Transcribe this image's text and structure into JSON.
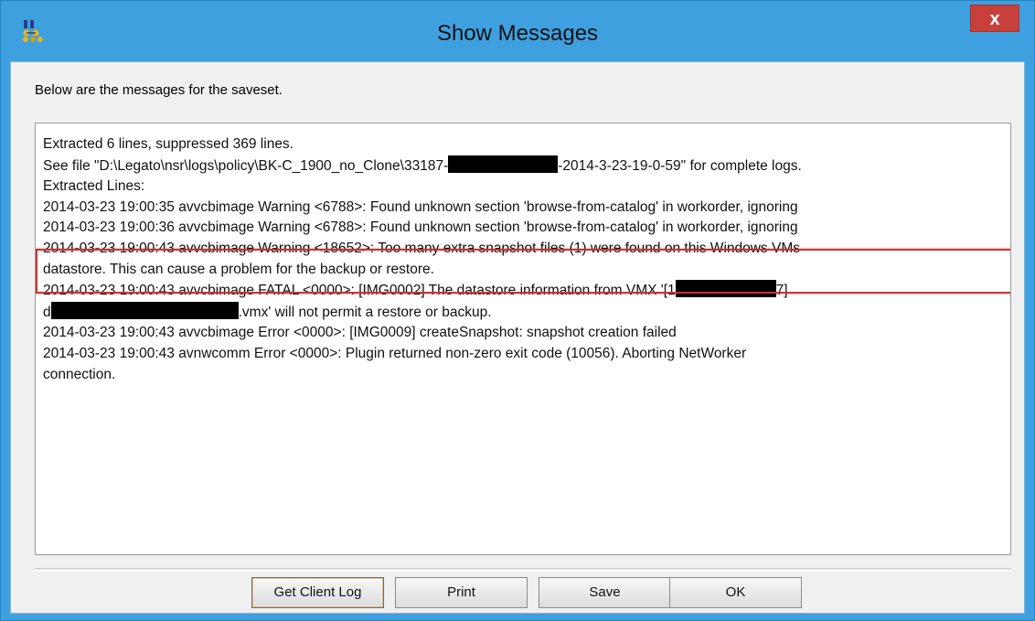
{
  "window": {
    "title": "Show Messages",
    "close_label": "x",
    "app_icon": "legato-networker-icon"
  },
  "intro_text": "Below are the messages for the saveset.",
  "messages": {
    "line1": "Extracted 6 lines, suppressed 369 lines.",
    "line2_before": "See file \"D:\\Legato\\nsr\\logs\\policy\\BK-C_1900_no_Clone\\33187-",
    "line2_after": "-2014-3-23-19-0-59\" for complete logs.",
    "line3": "Extracted Lines:",
    "line4": "2014-03-23 19:00:35 avvcbimage Warning <6788>: Found unknown section 'browse-from-catalog' in workorder, ignoring",
    "line5": "2014-03-23 19:00:36 avvcbimage Warning <6788>: Found unknown section 'browse-from-catalog' in workorder, ignoring",
    "line6": "2014-03-23 19:00:43 avvcbimage Warning <18652>: Too many extra snapshot files (1) were found on this Windows VMs",
    "line7": "datastore. This can cause a problem for the backup or restore.",
    "line8_before": "2014-03-23 19:00:43 avvcbimage FATAL <0000>: [IMG0002] The datastore information from VMX '[1",
    "line8_after": "7]",
    "line9_before": "d",
    "line9_after": ".vmx' will not permit a restore or backup.",
    "line10": "2014-03-23 19:00:43 avvcbimage Error <0000>: [IMG0009] createSnapshot: snapshot creation failed",
    "line11": "2014-03-23 19:00:43 avnwcomm Error <0000>: Plugin returned non-zero exit code (10056). Aborting NetWorker",
    "line12": "connection."
  },
  "buttons": {
    "get_client_log": "Get Client Log",
    "print": "Print",
    "save": "Save",
    "ok": "OK"
  },
  "colors": {
    "titlebar": "#3ea0df",
    "close_button": "#c7403b",
    "highlight_border": "#d2312c",
    "dialog_background": "#f0f0f0"
  }
}
